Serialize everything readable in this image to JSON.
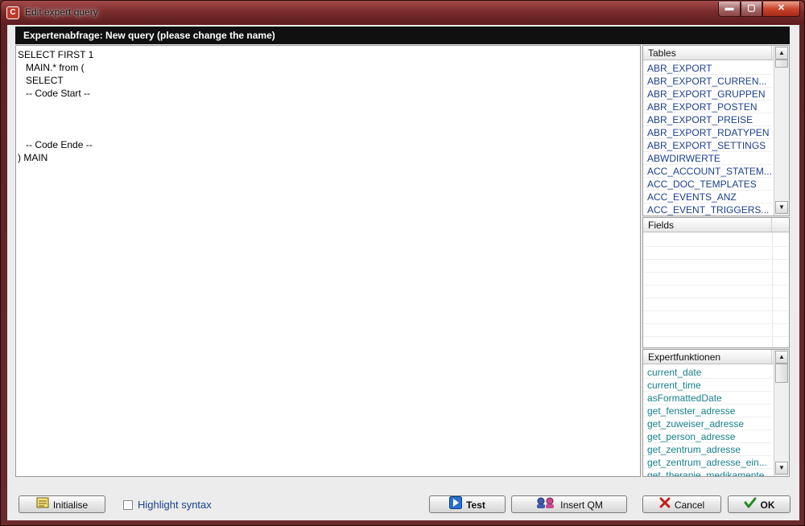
{
  "window": {
    "title": "Edit expert query",
    "app_icon_glyph": "C",
    "minimize_glyph": "▬",
    "maximize_glyph": "▢",
    "close_glyph": "✕"
  },
  "header": {
    "title": "Expertenabfrage: New query (please change the name)"
  },
  "editor": {
    "lines": [
      "SELECT FIRST 1",
      "   MAIN.* from (",
      "   SELECT",
      "   -- Code Start --",
      "",
      "",
      "",
      "   -- Code Ende --",
      ") MAIN"
    ]
  },
  "tables": {
    "header": "Tables",
    "items": [
      "ABR_EXPORT",
      "ABR_EXPORT_CURREN...",
      "ABR_EXPORT_GRUPPEN",
      "ABR_EXPORT_POSTEN",
      "ABR_EXPORT_PREISE",
      "ABR_EXPORT_RDATYPEN",
      "ABR_EXPORT_SETTINGS",
      "ABWDIRWERTE",
      "ACC_ACCOUNT_STATEM...",
      "ACC_DOC_TEMPLATES",
      "ACC_EVENTS_ANZ",
      "ACC_EVENT_TRIGGERS..."
    ]
  },
  "fields": {
    "header": "Fields"
  },
  "functions": {
    "header": "Expertfunktionen",
    "items": [
      "current_date",
      "current_time",
      "asFormattedDate",
      "get_fenster_adresse",
      "get_zuweiser_adresse",
      "get_person_adresse",
      "get_zentrum_adresse",
      "get_zentrum_adresse_ein...",
      "get_therapie_medikamente"
    ]
  },
  "scroll": {
    "up_glyph": "▲",
    "down_glyph": "▼"
  },
  "buttons": {
    "initialise": "Initialise",
    "test": "Test",
    "insert_qm": "Insert QM",
    "cancel": "Cancel",
    "ok": "OK"
  },
  "options": {
    "highlight_syntax": "Highlight syntax"
  },
  "colors": {
    "table_item": "#1b3f8f",
    "function_item": "#17808a",
    "header_bar": "#101010",
    "window_frame": "#6d2a2c"
  }
}
